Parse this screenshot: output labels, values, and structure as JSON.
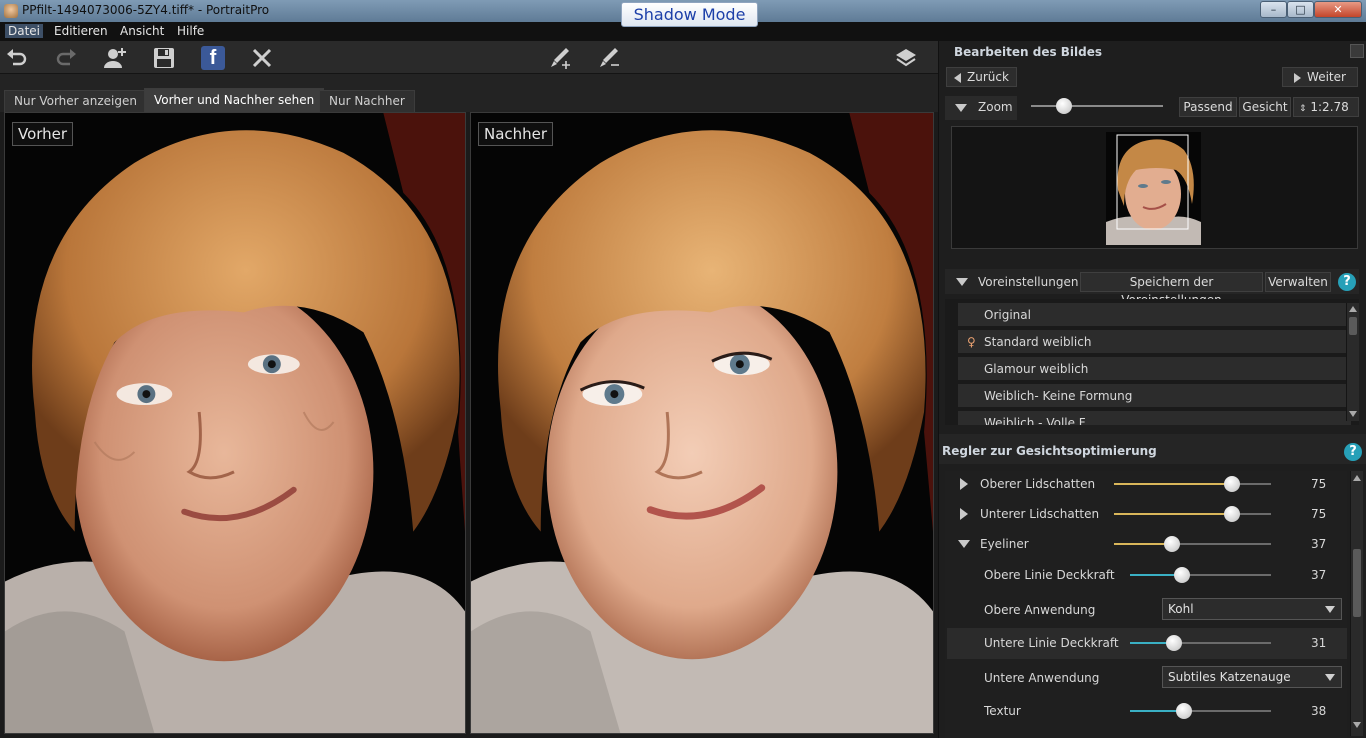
{
  "window": {
    "title": "PPfilt-1494073006-5ZY4.tiff* - PortraitPro",
    "mode_badge": "Shadow Mode",
    "minimize": "–",
    "maximize": "□",
    "close": "✕"
  },
  "menu": [
    "Datei",
    "Editieren",
    "Ansicht",
    "Hilfe"
  ],
  "toolbar": {
    "icons": [
      "undo-icon",
      "redo-icon",
      "add-person-icon",
      "save-icon",
      "facebook-icon",
      "close-icon",
      "brush-add-icon",
      "brush-remove-icon",
      "layers-icon"
    ],
    "facebook_glyph": "f"
  },
  "tabs": [
    "Nur Vorher anzeigen",
    "Vorher und Nachher sehen",
    "Nur Nachher"
  ],
  "panes": {
    "before_label": "Vorher",
    "after_label": "Nachher"
  },
  "right": {
    "edit_title": "Bearbeiten des Bildes",
    "back": "Zurück",
    "next": "Weiter",
    "zoom_label": "Zoom",
    "zoom_level": 0.25,
    "fit": "Passend",
    "face": "Gesicht",
    "ratio": "1:2.78",
    "presets_label": "Voreinstellungen",
    "save_presets": "Speichern der Voreinstellungen",
    "manage": "Verwalten",
    "help": "?",
    "preset_items": [
      "Original",
      "Standard weiblich",
      "Glamour weiblich",
      "Weiblich- Keine Formung",
      "Weiblich - Volle F..."
    ],
    "female_glyph": "♀",
    "optimizer_title": "Regler zur Gesichtsoptimierung",
    "sliders": [
      {
        "label": "Oberer Lidschatten",
        "value": 75,
        "max": 100
      },
      {
        "label": "Unterer Lidschatten",
        "value": 75,
        "max": 100
      },
      {
        "label": "Eyeliner",
        "value": 37,
        "max": 100
      },
      {
        "label": "Obere Linie Deckkraft",
        "value": 37,
        "max": 100
      },
      {
        "label": "Untere Linie Deckkraft",
        "value": 31,
        "max": 100
      },
      {
        "label": "Textur",
        "value": 38,
        "max": 100
      }
    ],
    "upper_application_label": "Obere Anwendung",
    "upper_application_value": "Kohl",
    "lower_application_label": "Untere Anwendung",
    "lower_application_value": "Subtiles Katzenauge",
    "colors": {
      "gold": "#d9b65a",
      "teal": "#3ab0c4"
    }
  }
}
